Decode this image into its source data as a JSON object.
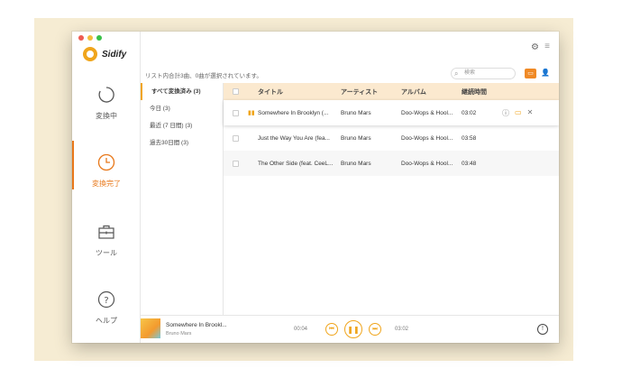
{
  "app": {
    "name": "Sidify"
  },
  "colors": {
    "accent": "#f0a51c",
    "active_nav": "#e8781a",
    "header_bg": "#fbe9cf",
    "backdrop": "#f6ecd3"
  },
  "sidebar": {
    "items": [
      {
        "label": "変換中",
        "icon": "sync-icon"
      },
      {
        "label": "変換完了",
        "icon": "clock-icon",
        "active": true
      },
      {
        "label": "ツール",
        "icon": "toolbox-icon"
      },
      {
        "label": "ヘルプ",
        "icon": "help-icon"
      }
    ]
  },
  "info": {
    "text": "リスト内合計3曲、0曲が選択されています。"
  },
  "search": {
    "placeholder": "検索"
  },
  "categories": [
    {
      "label": "すべて変換済み (3)"
    },
    {
      "label": "今日 (3)"
    },
    {
      "label": "最近 (7 日間) (3)"
    },
    {
      "label": "過去30日間 (3)"
    }
  ],
  "table": {
    "columns": {
      "title": "タイトル",
      "artist": "アーティスト",
      "album": "アルバム",
      "duration": "継続時間"
    },
    "rows": [
      {
        "title": "Somewhere In Brooklyn (...",
        "artist": "Bruno Mars",
        "album": "Doo-Wops & Hool...",
        "duration": "03:02"
      },
      {
        "title": "Just the Way You Are (fea...",
        "artist": "Bruno Mars",
        "album": "Doo-Wops & Hool...",
        "duration": "03:58"
      },
      {
        "title": "The Other Side (feat. CeeL...",
        "artist": "Bruno Mars",
        "album": "Doo-Wops & Hool...",
        "duration": "03:48"
      }
    ]
  },
  "player": {
    "title": "Somewhere In Brookl...",
    "artist": "Bruno Mars",
    "current_time": "00:04",
    "total_time": "03:02"
  }
}
